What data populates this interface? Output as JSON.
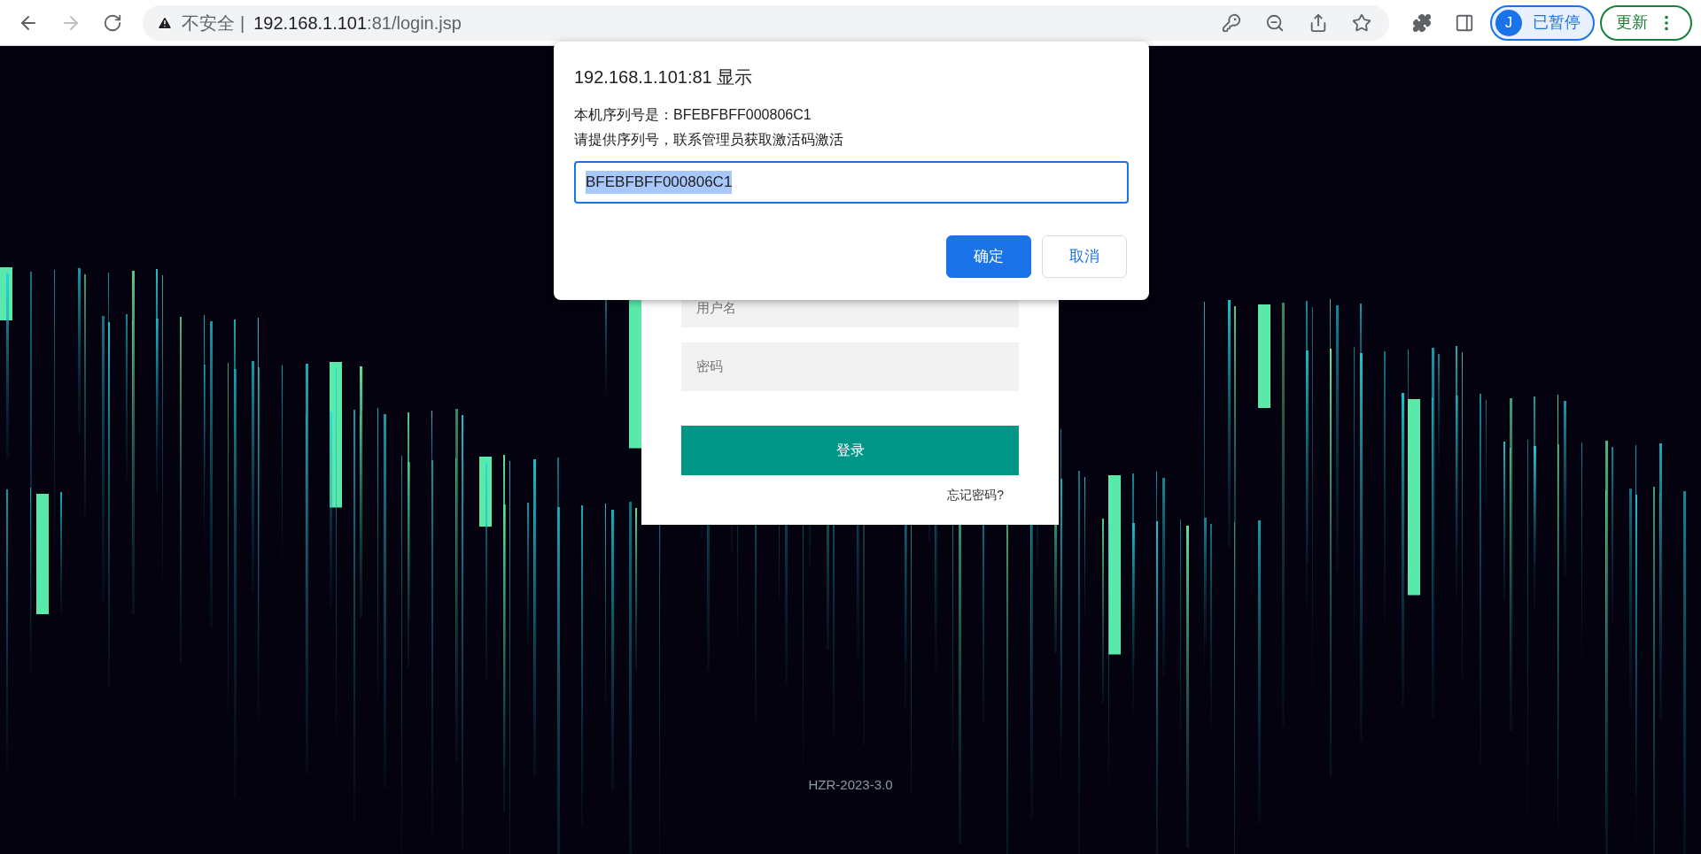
{
  "browser": {
    "address": {
      "security_label": "不安全",
      "separator": "|",
      "host": "192.168.1.101",
      "path": ":81/login.jsp"
    },
    "profile": {
      "initial": "J",
      "status": "已暂停"
    },
    "update_button": "更新"
  },
  "dialog": {
    "title": "192.168.1.101:81 显示",
    "message_lines": [
      "本机序列号是：BFEBFBFF000806C1",
      "请提供序列号，联系管理员获取激活码激活"
    ],
    "input": {
      "value": "BFEBFBFF000806C1",
      "text_selected": true
    },
    "buttons": [
      {
        "label": "确定",
        "kind": "primary"
      },
      {
        "label": "取消",
        "kind": "secondary"
      }
    ]
  },
  "login": {
    "username_placeholder": "用户名",
    "password_placeholder": "密码",
    "submit": "登录",
    "forgot_link": "忘记密码?"
  },
  "footer": "HZR-2023-3.0"
}
